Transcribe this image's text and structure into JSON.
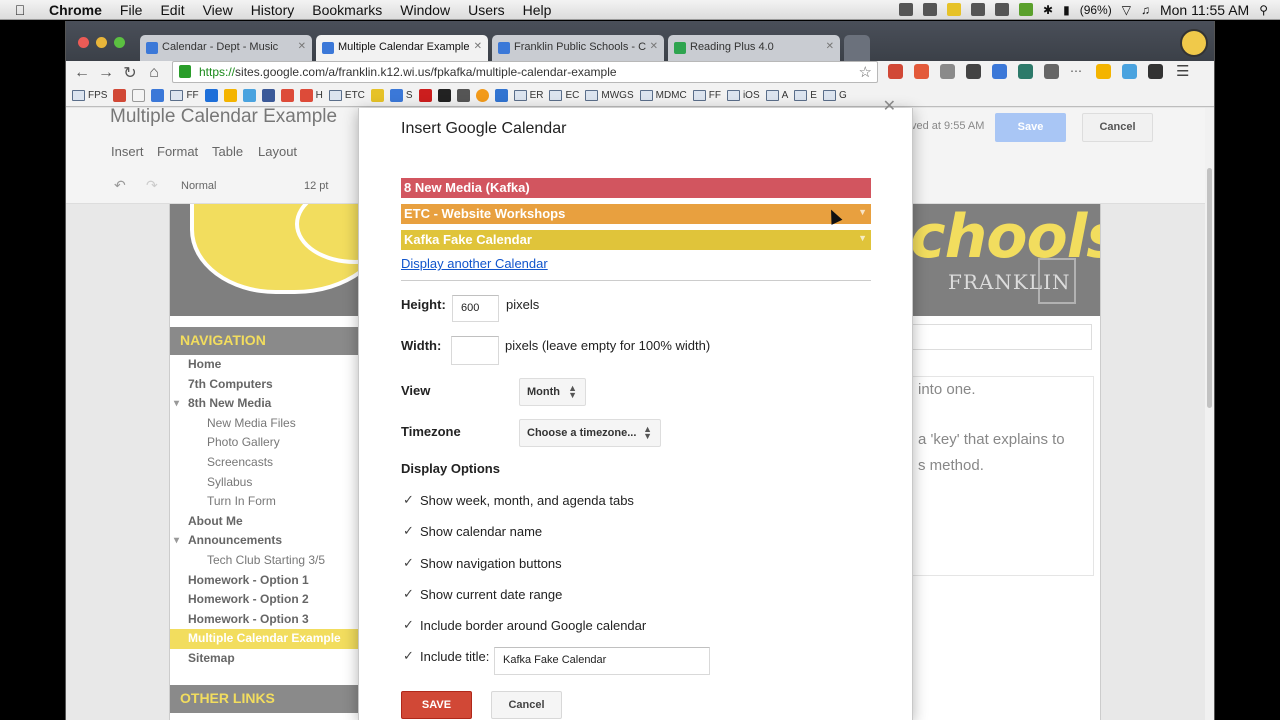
{
  "menubar": {
    "app": "Chrome",
    "items": [
      "File",
      "Edit",
      "View",
      "History",
      "Bookmarks",
      "Window",
      "Users",
      "Help"
    ],
    "battery": "(96%)",
    "clock": "Mon 11:55 AM"
  },
  "tabs": [
    {
      "title": "Calendar - Dept - Music"
    },
    {
      "title": "Multiple Calendar Example"
    },
    {
      "title": "Franklin Public Schools - C"
    },
    {
      "title": "Reading Plus 4.0"
    }
  ],
  "address": {
    "scheme": "https://",
    "rest": "sites.google.com/a/franklin.k12.wi.us/fpkafka/multiple-calendar-example"
  },
  "bookmarks": [
    "FPS",
    "H",
    "ETC",
    "S",
    "ER",
    "EC",
    "MWGS",
    "MDMC",
    "FF",
    "iOS",
    "A",
    "E",
    "G"
  ],
  "editor": {
    "site_title": "Multiple Calendar Example",
    "menus": [
      "Insert",
      "Format",
      "Table",
      "Layout"
    ],
    "style": "Normal",
    "size": "12 pt",
    "saved": "ved at 9:55 AM",
    "save": "Save",
    "cancel": "Cancel"
  },
  "site": {
    "banner_text": "chools",
    "banner_sub": "FRANKLIN",
    "nav_header": "NAVIGATION",
    "nav": [
      {
        "label": "Home",
        "level": 0
      },
      {
        "label": "7th Computers",
        "level": 0
      },
      {
        "label": "8th New Media",
        "level": 0,
        "expanded": true
      },
      {
        "label": "New Media Files",
        "level": 1
      },
      {
        "label": "Photo Gallery",
        "level": 1
      },
      {
        "label": "Screencasts",
        "level": 1
      },
      {
        "label": "Syllabus",
        "level": 1
      },
      {
        "label": "Turn In Form",
        "level": 1
      },
      {
        "label": "About Me",
        "level": 0
      },
      {
        "label": "Announcements",
        "level": 0,
        "expanded": true
      },
      {
        "label": "Tech Club Starting 3/5",
        "level": 1
      },
      {
        "label": "Homework - Option 1",
        "level": 0
      },
      {
        "label": "Homework - Option 2",
        "level": 0
      },
      {
        "label": "Homework - Option 3",
        "level": 0
      },
      {
        "label": "Multiple Calendar Example",
        "level": 0,
        "current": true
      },
      {
        "label": "Sitemap",
        "level": 0
      }
    ],
    "other_header": "OTHER LINKS",
    "content_lines": [
      "into one.",
      "a 'key' that explains to",
      "s method."
    ]
  },
  "dialog": {
    "title": "Insert Google Calendar",
    "calendars": [
      {
        "name": "8 New Media (Kafka)",
        "color": "#d2555f"
      },
      {
        "name": "ETC - Website Workshops",
        "color": "#e8a03f"
      },
      {
        "name": "Kafka Fake Calendar",
        "color": "#e0c43a"
      }
    ],
    "another_link": "Display another Calendar",
    "height_label": "Height:",
    "height_value": "600",
    "height_suffix": "pixels",
    "width_label": "Width:",
    "width_value": "",
    "width_suffix": "pixels (leave empty for 100% width)",
    "view_label": "View",
    "view_value": "Month",
    "timezone_label": "Timezone",
    "timezone_value": "Choose a timezone...",
    "options_heading": "Display Options",
    "options": [
      {
        "label": "Show week, month, and agenda tabs",
        "checked": true
      },
      {
        "label": "Show calendar name",
        "checked": true
      },
      {
        "label": "Show navigation buttons",
        "checked": true
      },
      {
        "label": "Show current date range",
        "checked": true
      },
      {
        "label": "Include border around Google calendar",
        "checked": true
      },
      {
        "label": "Include title:",
        "checked": true
      }
    ],
    "title_value": "Kafka Fake Calendar",
    "save": "SAVE",
    "cancel": "Cancel"
  },
  "colors": {
    "accent_yellow": "#f2dd5e",
    "save_red": "#d14836",
    "link_blue": "#1155cc"
  }
}
